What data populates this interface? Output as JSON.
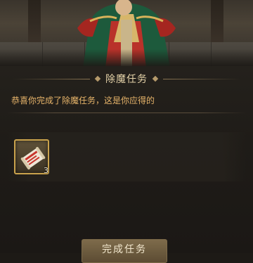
{
  "dialog": {
    "title": "除魔任务",
    "message": "恭喜你完成了除魔任务，这是你应得的"
  },
  "rewards": [
    {
      "icon": "scroll-icon",
      "count": "3"
    }
  ],
  "actions": {
    "complete_label": "完成任务"
  },
  "colors": {
    "title": "#e4d2a8",
    "message": "#e7b46a",
    "slot_border": "#c9a24c",
    "button": "#6e5c40"
  }
}
